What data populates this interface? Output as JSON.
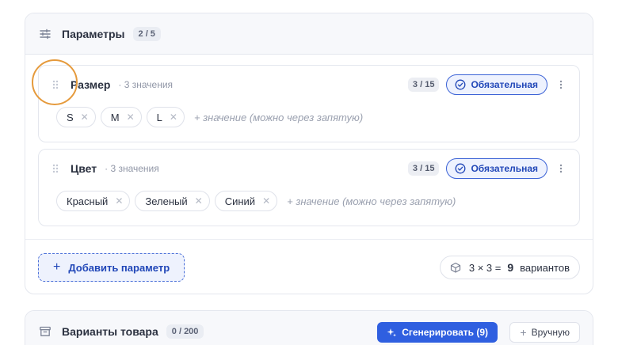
{
  "params": {
    "title": "Параметры",
    "count": "2 / 5",
    "items": [
      {
        "name": "Размер",
        "count": "· 3 значения",
        "limit": "3 / 15",
        "required_label": "Обязательная",
        "values": [
          "S",
          "M",
          "L"
        ],
        "add_placeholder": "+ значение (можно через запятую)"
      },
      {
        "name": "Цвет",
        "count": "· 3 значения",
        "limit": "3 / 15",
        "required_label": "Обязательная",
        "values": [
          "Красный",
          "Зеленый",
          "Синий"
        ],
        "add_placeholder": "+ значение (можно через запятую)"
      }
    ],
    "add_button": "Добавить параметр",
    "combo_formula": "3 × 3 =",
    "combo_total": "9",
    "combo_suffix": "вариантов"
  },
  "variants": {
    "title": "Варианты товара",
    "count": "0 / 200",
    "generate_button": "Сгенерировать (9)",
    "manual_button": "Вручную"
  },
  "colors": {
    "accent": "#2f5fe0",
    "focus_ring": "#e59a3c"
  },
  "icons": {
    "params_header": "sliders-icon",
    "variants_header": "archive-box-icon",
    "drag": "drag-handle-icon",
    "required": "check-circle-icon",
    "more": "kebab-menu-icon",
    "combo": "cube-icon",
    "generate": "sparkles-icon"
  }
}
